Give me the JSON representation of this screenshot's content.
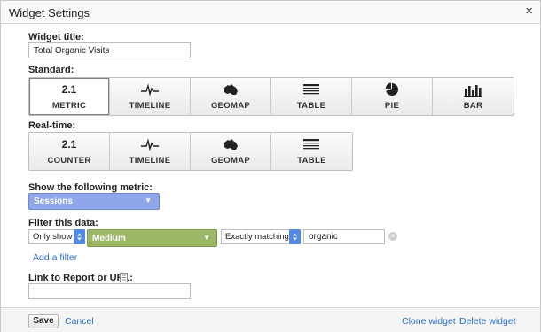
{
  "window": {
    "title": "Widget Settings",
    "close_glyph": "×"
  },
  "widget_title": {
    "label": "Widget title:",
    "value": "Total Organic Visits"
  },
  "standard": {
    "label": "Standard:",
    "tiles": [
      {
        "icon": "2.1",
        "label": "METRIC",
        "selected": true
      },
      {
        "icon": "timeline-icon",
        "label": "TIMELINE"
      },
      {
        "icon": "geomap-icon",
        "label": "GEOMAP"
      },
      {
        "icon": "table-icon",
        "label": "TABLE"
      },
      {
        "icon": "pie-icon",
        "label": "PIE"
      },
      {
        "icon": "bar-icon",
        "label": "BAR"
      }
    ]
  },
  "realtime": {
    "label": "Real-time:",
    "tiles": [
      {
        "icon": "2.1",
        "label": "COUNTER"
      },
      {
        "icon": "timeline-icon",
        "label": "TIMELINE"
      },
      {
        "icon": "geomap-icon",
        "label": "GEOMAP"
      },
      {
        "icon": "table-icon",
        "label": "TABLE"
      }
    ]
  },
  "metric": {
    "label": "Show the following metric:",
    "value": "Sessions",
    "color": "#8fa6ea"
  },
  "filter": {
    "label": "Filter this data:",
    "mode": "Only show",
    "dimension": "Medium",
    "dimension_color": "#9cb768",
    "match_type": "Exactly matching",
    "value": "organic",
    "add_filter": "Add a filter"
  },
  "link": {
    "label": "Link to Report or URL:",
    "value": ""
  },
  "footer": {
    "save": "Save",
    "cancel": "Cancel",
    "clone": "Clone widget",
    "delete": "Delete widget"
  },
  "colors": {
    "link": "#2b6fcf",
    "select_arrows": "#4f8be6"
  }
}
